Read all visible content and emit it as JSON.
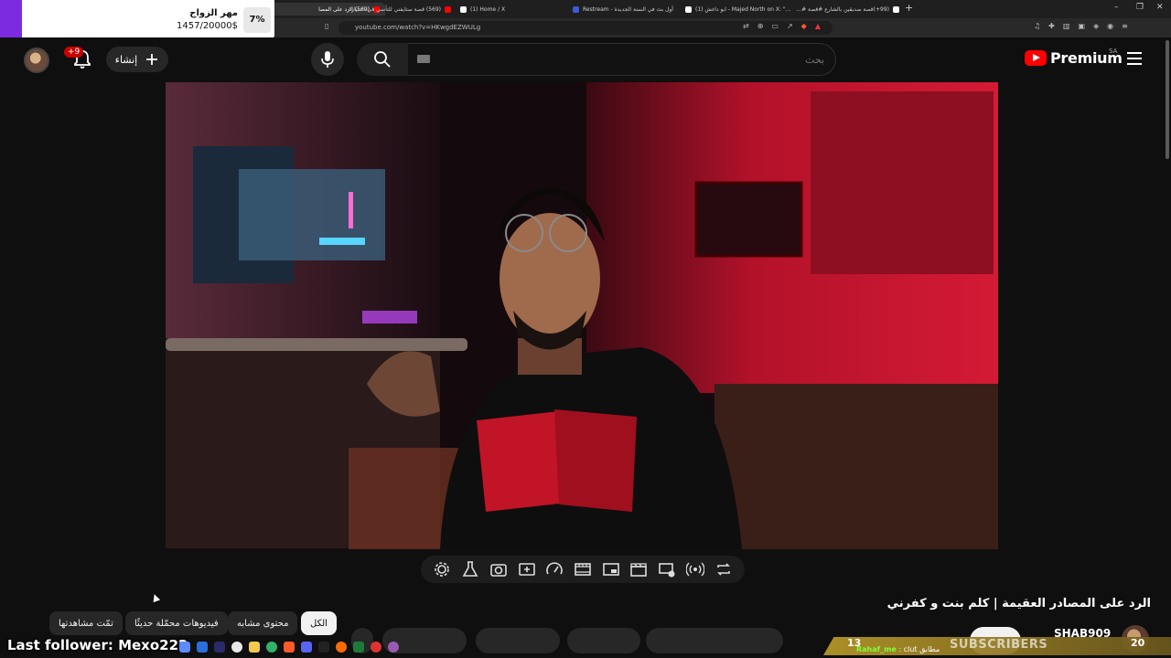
{
  "browser": {
    "tabs": [
      {
        "label": "(569) الرد على المصا",
        "color": "#ff0000",
        "active": true
      },
      {
        "label": "(569) قصة ستايفني للتأسي في السيارة",
        "color": "#ff0000",
        "active": false
      },
      {
        "label": "(1) Home / X",
        "color": "#ffffff",
        "active": false
      },
      {
        "label": "Restream - أول بث في السنة الجديدة",
        "color": "#3b5bdb",
        "active": false
      },
      {
        "label": "(1) ابو داغش - Majed North on X: \"...",
        "color": "#ffffff",
        "active": false
      },
      {
        "label": "(99+)قصة صديقين بالشارع #قصة #...",
        "color": "#ffffff",
        "active": false
      }
    ],
    "new_tab": "+",
    "url": "youtube.com/watch?v=HKwgdEZWULg"
  },
  "donation": {
    "title": "مهر الزواج",
    "amount": "1457/20000$",
    "percent": "7%",
    "progress": 0.07,
    "accent": "#7c2be0"
  },
  "header": {
    "notifications_badge": "+9",
    "create_label": "إنشاء",
    "search_placeholder": "بحث",
    "logo_text": "Premium",
    "country": "SA"
  },
  "video": {
    "title": "الرد على المصادر العقيمة | كلم بنت و كفرني"
  },
  "controls": [
    "gear-icon",
    "beaker-icon",
    "camera-icon",
    "add-clip-icon",
    "speed-icon",
    "filmstrip-icon",
    "picture-in-picture-icon",
    "clapper-icon",
    "screen-cast-icon",
    "broadcast-icon",
    "loop-icon"
  ],
  "chips": [
    {
      "label": "الكل",
      "active": true
    },
    {
      "label": "محتوى مشابه",
      "active": false
    },
    {
      "label": "فيديوهات محمّلة حديثًا",
      "active": false
    },
    {
      "label": "تمّت مشاهدتها",
      "active": false
    }
  ],
  "channel": {
    "name": "SHAB909"
  },
  "overlay": {
    "last_follower": "Last follower: Mexo222",
    "sub_left_count": "13",
    "sub_label": "SUBSCRIBERS",
    "sub_right_count": "20",
    "chat_user": "Rahaf_me",
    "chat_text": ": clut مطابق"
  }
}
